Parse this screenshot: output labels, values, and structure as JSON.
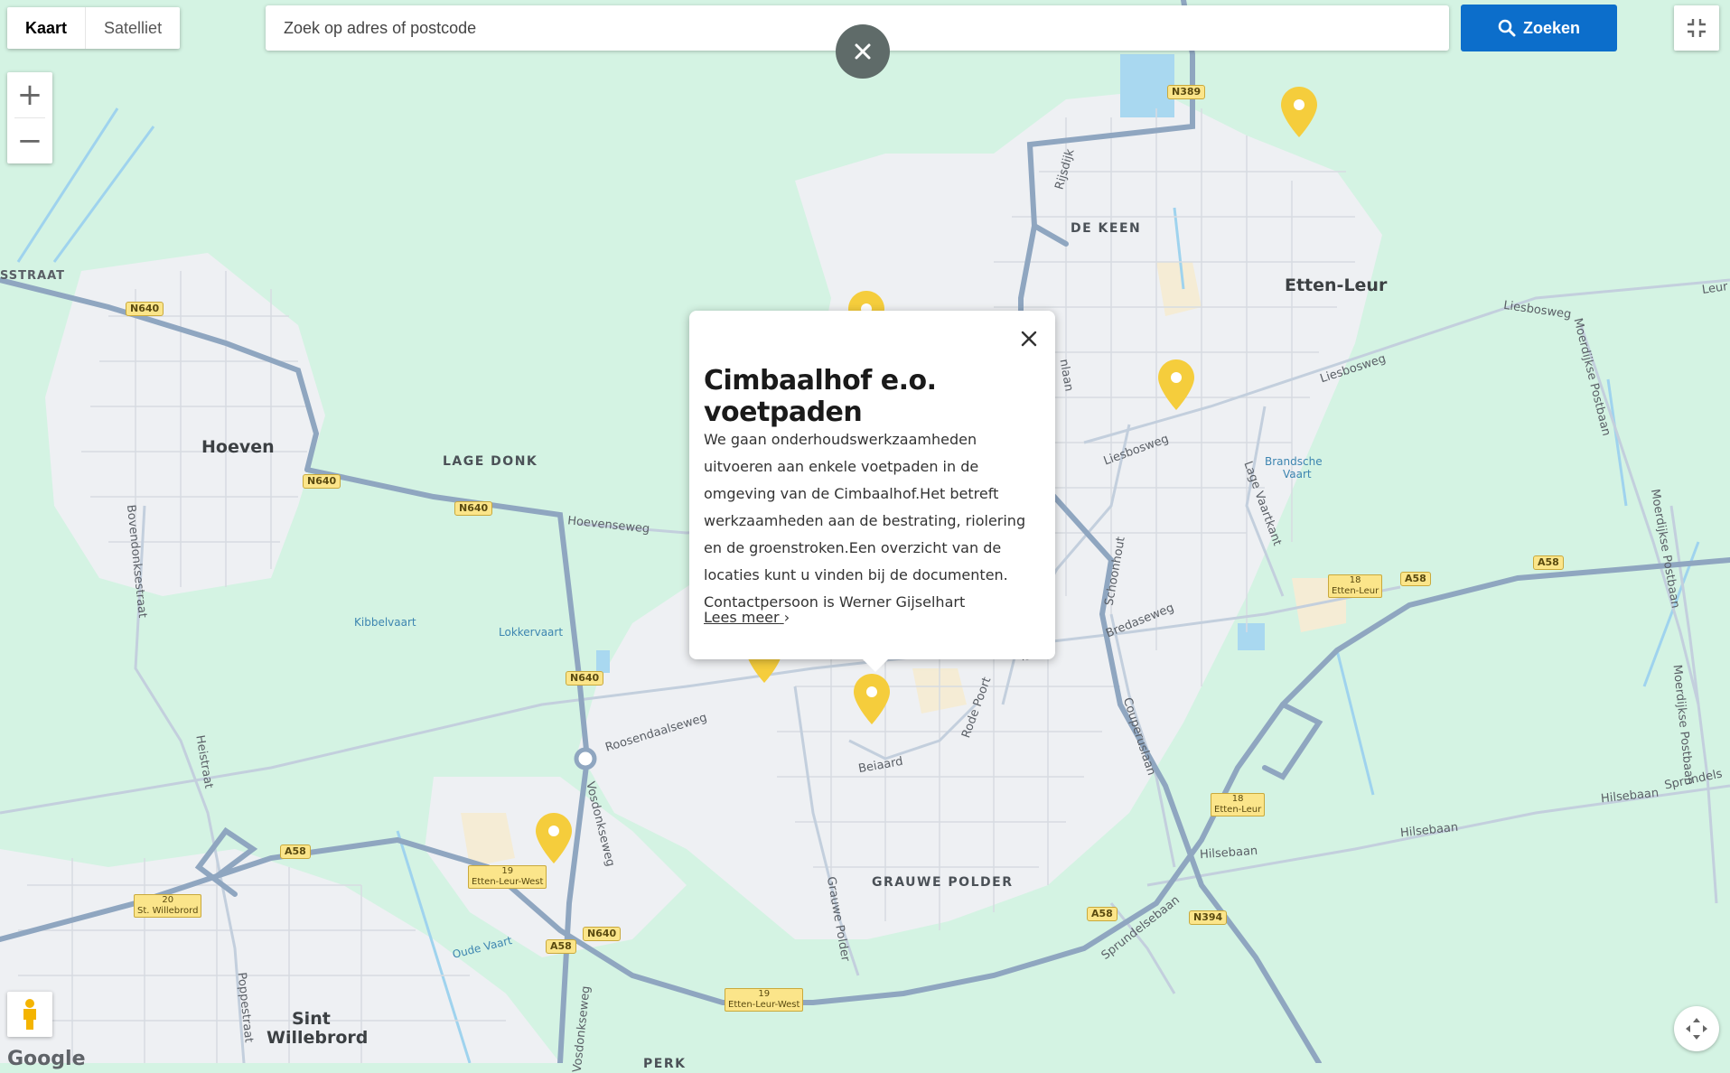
{
  "map_type": {
    "map_label": "Kaart",
    "satellite_label": "Satelliet",
    "active": "Kaart"
  },
  "search": {
    "placeholder": "Zoek op adres of postcode",
    "value": "",
    "button_label": "Zoeken"
  },
  "controls": {
    "zoom_in": "+",
    "zoom_out": "−",
    "fullscreen_icon": "exit-fullscreen-icon",
    "pegman_icon": "pegman-icon",
    "compass_icon": "recenter-icon"
  },
  "popup": {
    "title": "Cimbaalhof e.o. voetpaden",
    "description": "We gaan onderhoudswerkzaamheden uitvoeren aan enkele voetpaden in de omgeving van de Cimbaalhof.Het betreft werkzaamheden aan de bestrating, riolering en de groenstroken.Een overzicht van de locaties kunt u vinden bij de documenten. Contactpersoon is Werner Gijselhart",
    "more_label": "Lees meer"
  },
  "places": {
    "hoeven": "Hoeven",
    "lage_donk": "LAGE DONK",
    "de_keen": "DE KEEN",
    "etten_leur": "Etten-Leur",
    "grauwe_polder_area": "GRAUWE POLDER",
    "sint": "Sint",
    "willebrord": "Willebrord",
    "perk": "PERK"
  },
  "streets": {
    "sstraat": "SSTRAAT",
    "hoevenseweg": "Hoevenseweg",
    "bovendonksestraat": "Bovendonksestraat",
    "heistraat": "Heistraat",
    "poppestraat": "Poppestraat",
    "roosendaalseweg": "Roosendaalseweg",
    "vosdonkseweg": "Vosdonkseweg",
    "vosdonkseweg2": "Vosdonkseweg",
    "beiaard": "Beiaard",
    "rode_poort": "Rode Poort",
    "grauwe_polder": "Grauwe Polder",
    "schoonhout": "Schoonhout",
    "lage_vaartkant": "Lage Vaartkant",
    "liesbosweg1": "Liesbosweg",
    "liesbosweg2": "Liesbosweg",
    "liesbosweg3": "Liesbosweg",
    "bredaseweg": "Bredaseweg",
    "couperuslaan": "Couperuslaan",
    "hilsebaan1": "Hilsebaan",
    "hilsebaan2": "Hilsebaan",
    "hilsebaan3": "Hilsebaan",
    "sprundelsebaan": "Sprundelsebaan",
    "sprundels": "Sprundels",
    "moerdijkse1": "Moerdijkse Postbaan",
    "moerdijkse2": "Moerdijkse Postbaan",
    "moerdijkse3": "Moerdijkse Postbaan",
    "rijsdijk": "Rijsdijk",
    "leur": "Leur",
    "laan_frag": "laan",
    "laan_frag2": "nlaan"
  },
  "water": {
    "kibbelvaart": "Kibbelvaart",
    "lokkervaart": "Lokkervaart",
    "oude_vaart": "Oude Vaart",
    "brandsche_1": "Brandsche",
    "brandsche_2": "Vaart"
  },
  "shields": {
    "n640_a": "N640",
    "n640_b": "N640",
    "n640_c": "N640",
    "n640_d": "N640",
    "n640_e": "N640",
    "n389": "N389",
    "n394": "N394",
    "a58_a": "A58",
    "a58_b": "A58",
    "a58_c": "A58",
    "a58_d": "A58",
    "a58_e": "A58"
  },
  "exits": {
    "e18a_num": "18",
    "e18a_name": "Etten-Leur",
    "e18b_num": "18",
    "e18b_name": "Etten-Leur",
    "e19a_num": "19",
    "e19a_name": "Etten-Leur-West",
    "e19b_num": "19",
    "e19b_name": "Etten-Leur-West",
    "e20_num": "20",
    "e20_name": "St. Willebrord"
  },
  "attribution": "Google",
  "colors": {
    "land": "#d4f3e3",
    "urban": "#eef0f3",
    "water": "#a9d8f0",
    "road_major": "#8fa6c0",
    "road_minor": "#ffffff",
    "marker": "#f5cd3c",
    "button": "#0c6ecb"
  }
}
